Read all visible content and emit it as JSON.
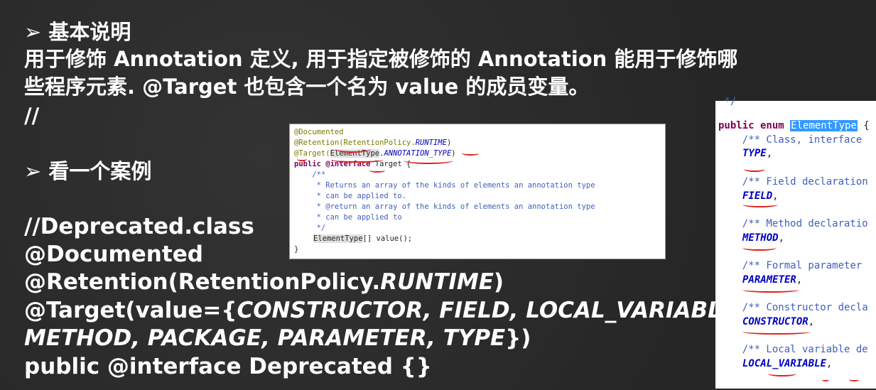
{
  "heading1": "➢ 基本说明",
  "desc_line1": "用于修饰 Annotation 定义, 用于指定被修饰的 Annotation 能用于修饰哪",
  "desc_line2": "些程序元素. @Target 也包含一个名为 value 的成员变量。",
  "comment_slashes": "//",
  "heading2": "➢ 看一个案例",
  "example": {
    "line1": "//Deprecated.class",
    "line2": "@Documented",
    "line3_prefix": "@Retention(RetentionPolicy.",
    "line3_italic": "RUNTIME",
    "line3_suffix": ")",
    "line4_prefix": "@Target(value={",
    "line4_italic": "CONSTRUCTOR, FIELD, LOCAL_VARIABLE,",
    "line5_italic": "METHOD, PACKAGE, PARAMETER, TYPE",
    "line5_suffix": "})",
    "line6": "public @interface Deprecated {}"
  },
  "target_source": {
    "l1": "@Documented",
    "l2a": "@Retention(RetentionPolicy.",
    "l2b": "RUNTIME",
    "l2c": ")",
    "l3a": "@Target(",
    "l3b": "ElementType",
    "l3c": ".",
    "l3d": "ANNOTATION_TYPE",
    "l3e": ")",
    "l4a": "public @interface",
    "l4b": " Target {",
    "l5": "    /**",
    "l6": "     * Returns an array of the kinds of elements an annotation type",
    "l7": "     * can be applied to.",
    "l8": "     * @return an array of the kinds of elements an annotation type",
    "l9": "     * can be applied to",
    "l10": "     */",
    "l11a": "ElementType",
    "l11b": "[] value();",
    "l12": "}"
  },
  "element_type_source": {
    "top": " */",
    "decl_a": "public enum ",
    "decl_b": "ElementType",
    "decl_c": " {",
    "c1": "    /** Class, interface",
    "v1": "TYPE",
    "c2": "    /** Field declaration",
    "v2": "FIELD",
    "c3": "    /** Method declaratio",
    "v3": "METHOD",
    "c4": "    /** Formal parameter",
    "v4": "PARAMETER",
    "c5": "    /** Constructor decla",
    "v5": "CONSTRUCTOR",
    "c6": "    /** Local variable de",
    "v6": "LOCAL_VARIABLE"
  },
  "colors": {
    "background": "#2b2b2b",
    "annotation_red": "#e0201c",
    "enum_blue": "#0000c0"
  }
}
